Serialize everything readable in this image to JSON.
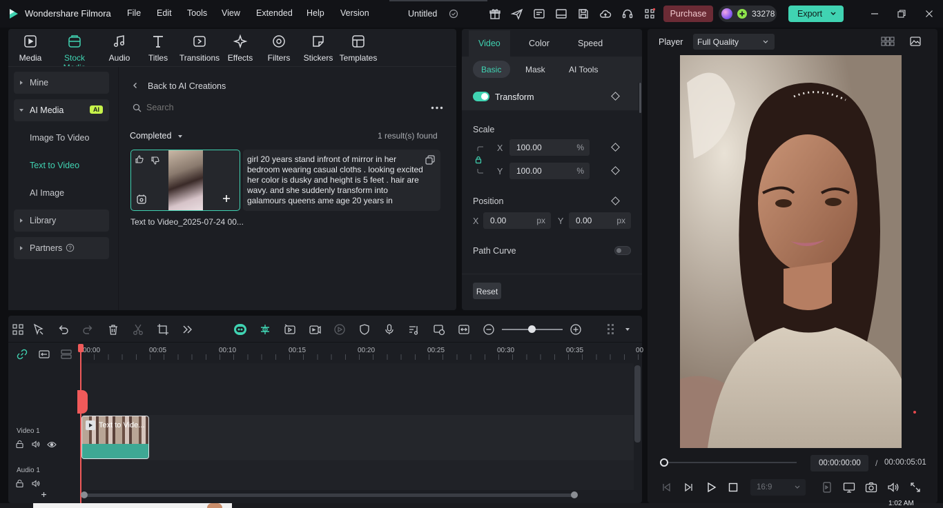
{
  "app": {
    "name": "Wondershare Filmora",
    "project_title": "Untitled",
    "menu": [
      "File",
      "Edit",
      "Tools",
      "View",
      "Extended",
      "Help",
      "Version"
    ],
    "purchase_label": "Purchase",
    "credits": "33278",
    "export_label": "Export",
    "accent_color": "#40d3b2",
    "purchase_color": "#6b2b35"
  },
  "toolbar": {
    "items": [
      {
        "label": "Media",
        "icon": "media-icon"
      },
      {
        "label": "Stock Media",
        "icon": "stock-media-icon"
      },
      {
        "label": "Audio",
        "icon": "music-note-icon"
      },
      {
        "label": "Titles",
        "icon": "text-t-icon"
      },
      {
        "label": "Transitions",
        "icon": "transition-icon"
      },
      {
        "label": "Effects",
        "icon": "effects-icon"
      },
      {
        "label": "Filters",
        "icon": "filter-icon"
      },
      {
        "label": "Stickers",
        "icon": "sticker-icon"
      },
      {
        "label": "Templates",
        "icon": "template-icon"
      }
    ],
    "active": "Stock Media"
  },
  "sidebar": {
    "mine": "Mine",
    "ai_media": "AI Media",
    "ai_badge": "AI",
    "image_to_video": "Image To Video",
    "text_to_video": "Text to Video",
    "ai_image": "AI Image",
    "library": "Library",
    "partners": "Partners"
  },
  "browser": {
    "back_label": "Back to AI Creations",
    "search_placeholder": "Search",
    "filter_label": "Completed",
    "results": "1 result(s) found",
    "clip_name": "Text to Video_2025-07-24 00...",
    "prompt": " girl 20 years stand infront of mirror in her bedroom wearing casual cloths . looking excited her color is dusky and height is 5 feet . hair are wavy. and she suddenly transform into galamours queens ame age 20 years in"
  },
  "properties": {
    "tabs": [
      "Video",
      "Color",
      "Speed"
    ],
    "active_tab": "Video",
    "subtabs": [
      "Basic",
      "Mask",
      "AI Tools"
    ],
    "active_subtab": "Basic",
    "transform_label": "Transform",
    "transform_on": true,
    "scale_label": "Scale",
    "scale_x": "100.00",
    "scale_y": "100.00",
    "percent": "%",
    "x_label": "X",
    "y_label": "Y",
    "position_label": "Position",
    "pos_x": "0.00",
    "pos_y": "0.00",
    "px": "px",
    "path_curve_label": "Path Curve",
    "reset_label": "Reset"
  },
  "player": {
    "label": "Player",
    "quality": "Full Quality",
    "current_time": "00:00:00:00",
    "separator": "/",
    "total_time": "00:00:05:01",
    "aspect": "16:9",
    "progress": 0
  },
  "timeline": {
    "ruler": [
      "00:00",
      "00:05",
      "00:10",
      "00:15",
      "00:20",
      "00:25",
      "00:30",
      "00:35",
      "00"
    ],
    "video_track": "Video 1",
    "audio_track": "Audio 1",
    "clip_label": "Text to Vide..."
  },
  "taskbar": {
    "clock": "1:02 AM"
  }
}
